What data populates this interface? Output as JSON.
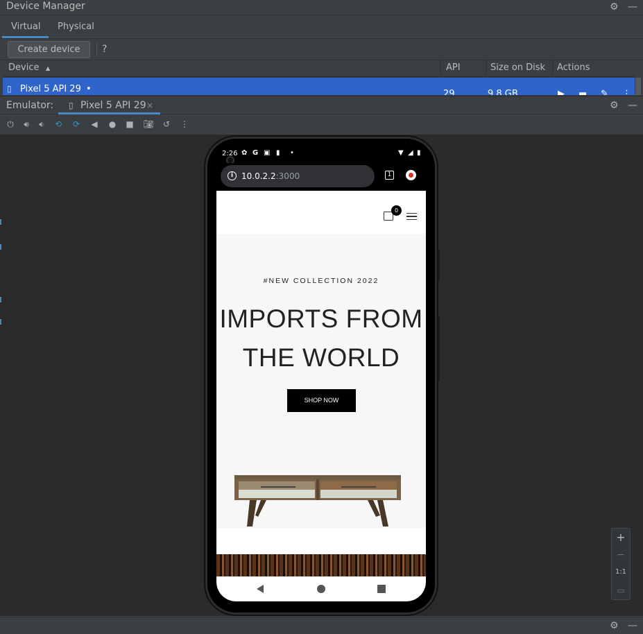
{
  "device_manager": {
    "title": "Device Manager",
    "tabs": [
      "Virtual",
      "Physical"
    ],
    "create_device_label": "Create device",
    "help_label": "?",
    "columns": [
      "Device",
      "API",
      "Size on Disk",
      "Actions"
    ],
    "rows": [
      {
        "device": "Pixel 5 API 29",
        "api": "29",
        "size": "9.8 GB"
      }
    ]
  },
  "emulator": {
    "label": "Emulator:",
    "tab_label": "Pixel 5 API 29",
    "close_label": "×"
  },
  "phone": {
    "status_time": "2:26",
    "url_host": "10.0.2.2",
    "url_port": ":3000",
    "tabs_count": "1",
    "cart_count": "0",
    "hero_tag": "#NEW COLLECTION 2022",
    "hero_title_line1": "IMPORTS FROM",
    "hero_title_line2": "THE WORLD",
    "shop_button": "SHOP NOW"
  },
  "zoom_controls": {
    "zoom_in": "+",
    "zoom_out": "−",
    "one_to_one": "1:1"
  },
  "colors": {
    "accent": "#4a88c7",
    "selection": "#2f65ca",
    "panel": "#3c3f41",
    "viewport": "#2b2b2b"
  }
}
